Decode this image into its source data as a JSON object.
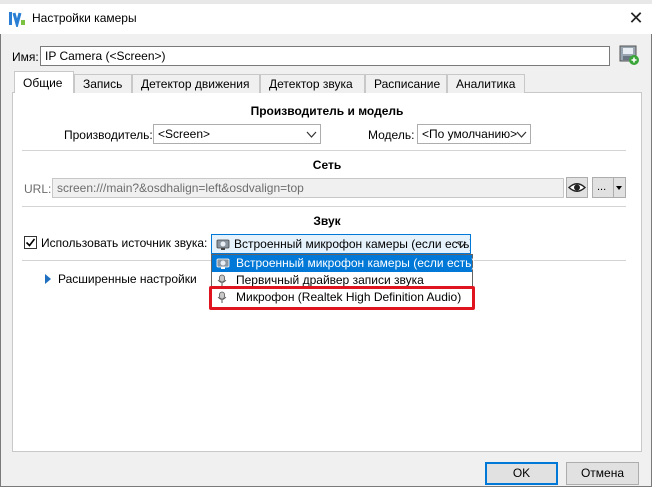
{
  "window": {
    "title": "Настройки камеры",
    "close_glyph": "✕"
  },
  "name": {
    "label": "Имя:",
    "value": "IP Camera (<Screen>)"
  },
  "tabs": [
    {
      "label": "Общие",
      "active": true
    },
    {
      "label": "Запись"
    },
    {
      "label": "Детектор движения"
    },
    {
      "label": "Детектор звука"
    },
    {
      "label": "Расписание"
    },
    {
      "label": "Аналитика"
    }
  ],
  "manufacturer": {
    "section_title": "Производитель и модель",
    "manufacturer_label": "Производитель:",
    "manufacturer_value": "<Screen>",
    "model_label": "Модель:",
    "model_value": "<По умолчанию>"
  },
  "network": {
    "section_title": "Сеть",
    "url_label": "URL:",
    "url_value": "screen:///main?&osdhalign=left&osdvalign=top",
    "more_label": "..."
  },
  "sound": {
    "section_title": "Звук",
    "use_source_label": "Использовать источник звука:",
    "use_source_checked": true,
    "selected_source": "Встроенный микрофон камеры (если есть)",
    "options": [
      "Встроенный микрофон камеры (если есть)",
      "Первичный драйвер записи звука",
      "Микрофон (Realtek High Definition Audio)"
    ]
  },
  "advanced": {
    "label": "Расширенные настройки"
  },
  "buttons": {
    "ok": "OK",
    "cancel": "Отмена"
  },
  "colors": {
    "accent": "#0078d7",
    "highlight": "#e0141e"
  }
}
